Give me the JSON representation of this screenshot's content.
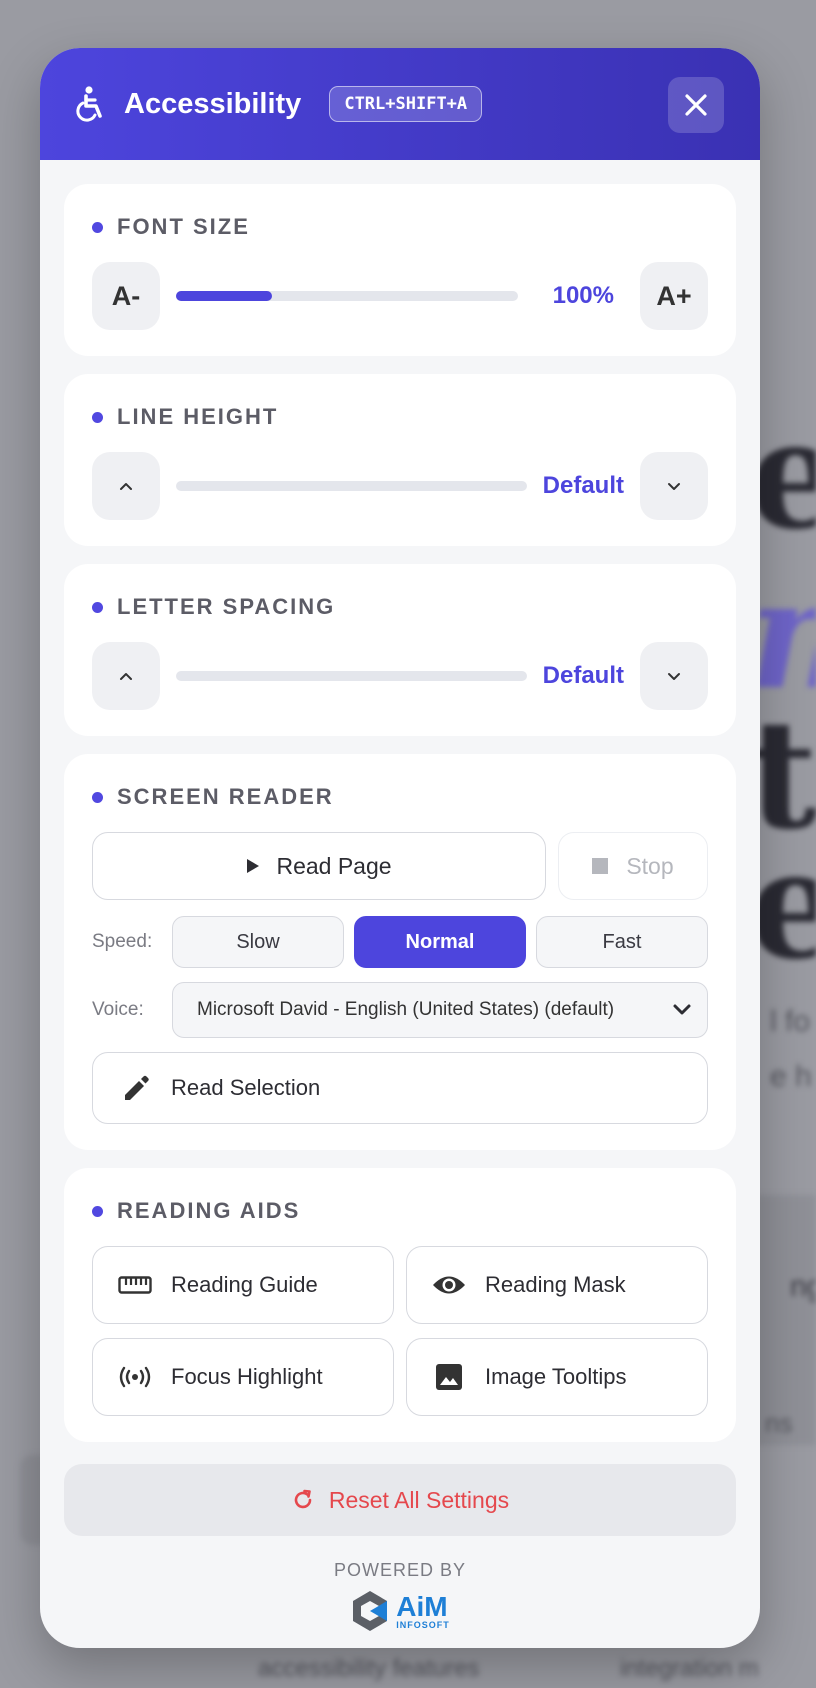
{
  "background": {
    "fragments": [
      "e",
      "m",
      "t",
      "e",
      "l fo",
      "e h",
      "ng",
      "ns",
      "accessibility features",
      "integration m"
    ]
  },
  "header": {
    "title": "Accessibility",
    "shortcut": "CTRL+SHIFT+A",
    "icon": "accessibility-icon",
    "close_icon": "close-icon"
  },
  "font_size": {
    "title": "FONT SIZE",
    "decrease_label": "A-",
    "increase_label": "A+",
    "value": "100%",
    "fill_fraction": 0.28
  },
  "line_height": {
    "title": "LINE HEIGHT",
    "value": "Default",
    "fill_fraction": 0
  },
  "letter_spacing": {
    "title": "LETTER SPACING",
    "value": "Default",
    "fill_fraction": 0
  },
  "screen_reader": {
    "title": "SCREEN READER",
    "read_page_label": "Read Page",
    "stop_label": "Stop",
    "speed_label": "Speed:",
    "speeds": [
      "Slow",
      "Normal",
      "Fast"
    ],
    "selected_speed": "Normal",
    "voice_label": "Voice:",
    "voice_value": "Microsoft David - English (United States) (default)",
    "read_selection_label": "Read Selection"
  },
  "reading_aids": {
    "title": "READING AIDS",
    "items": [
      {
        "label": "Reading Guide",
        "icon": "ruler-icon"
      },
      {
        "label": "Reading Mask",
        "icon": "eye-icon"
      },
      {
        "label": "Focus Highlight",
        "icon": "broadcast-icon"
      },
      {
        "label": "Image Tooltips",
        "icon": "image-icon"
      }
    ]
  },
  "reset_label": "Reset All Settings",
  "footer": {
    "powered_by": "POWERED BY",
    "logo_text": "AiM",
    "logo_subtext": "INFOSOFT"
  },
  "colors": {
    "accent": "#4d45dd",
    "danger": "#e5484d",
    "logo_blue": "#1e7fd6"
  }
}
